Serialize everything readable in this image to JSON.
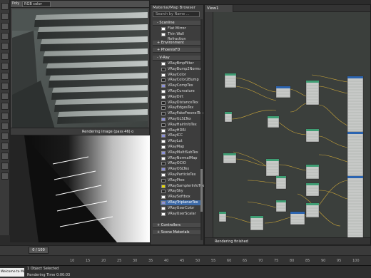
{
  "render_window": {
    "poly_label": "Poly",
    "channel": "RGB color",
    "status": "Rendering image (pass 46) o"
  },
  "material_browser": {
    "title": "Material/Map Browser",
    "search_placeholder": "Search by Name ...",
    "groups": {
      "scanline": "- Scanline",
      "environment": "+ Environment",
      "phoenix": "+ PhoenixFD",
      "vray": "- V-Ray",
      "controllers": "+ Controllers",
      "scene_materials": "+ Scene Materials"
    },
    "scanline_items": [
      "Flat Mirror",
      "Thin Wall Refraction"
    ],
    "vray_items": [
      "VRayBmpFilter",
      "VRayBump2Normal",
      "VRayColor",
      "VRayColor2Bump",
      "VRayCompTex",
      "VRayCurvature",
      "VRayDirt",
      "VRayDistanceTex",
      "VRayEdgesTex",
      "VRayFakeFresnelTex",
      "VRayGLSLTex",
      "VRayHairInfoTex",
      "VRayHDRI",
      "VRayICC",
      "VRayLut",
      "VRayMap",
      "VRayMultiSubTex",
      "VRayNormalMap",
      "VRayOCIO",
      "VRayOSLTex",
      "VRayParticleTex",
      "VRayPtex",
      "VRaySamplerInfoTex",
      "VRaySky",
      "VRaySoftbox",
      "VRayTriplanarTex",
      "VRayUserColor",
      "VRayUserScalar"
    ],
    "selected_item": "VRayTriplanarTex"
  },
  "node_editor": {
    "view_tab": "View1",
    "status": "Rendering finished"
  },
  "timeline": {
    "frame_display": "0 / 100",
    "ticks": [
      "10",
      "15",
      "20",
      "25",
      "30",
      "35",
      "40",
      "45",
      "50",
      "55",
      "60",
      "65",
      "70",
      "75",
      "80",
      "85",
      "90",
      "95",
      "100"
    ]
  },
  "status_bar": {
    "welcome": "Welcome to MAX",
    "selection": "1 Object Selected",
    "render_time": "Rendering Time 0:00:03"
  }
}
